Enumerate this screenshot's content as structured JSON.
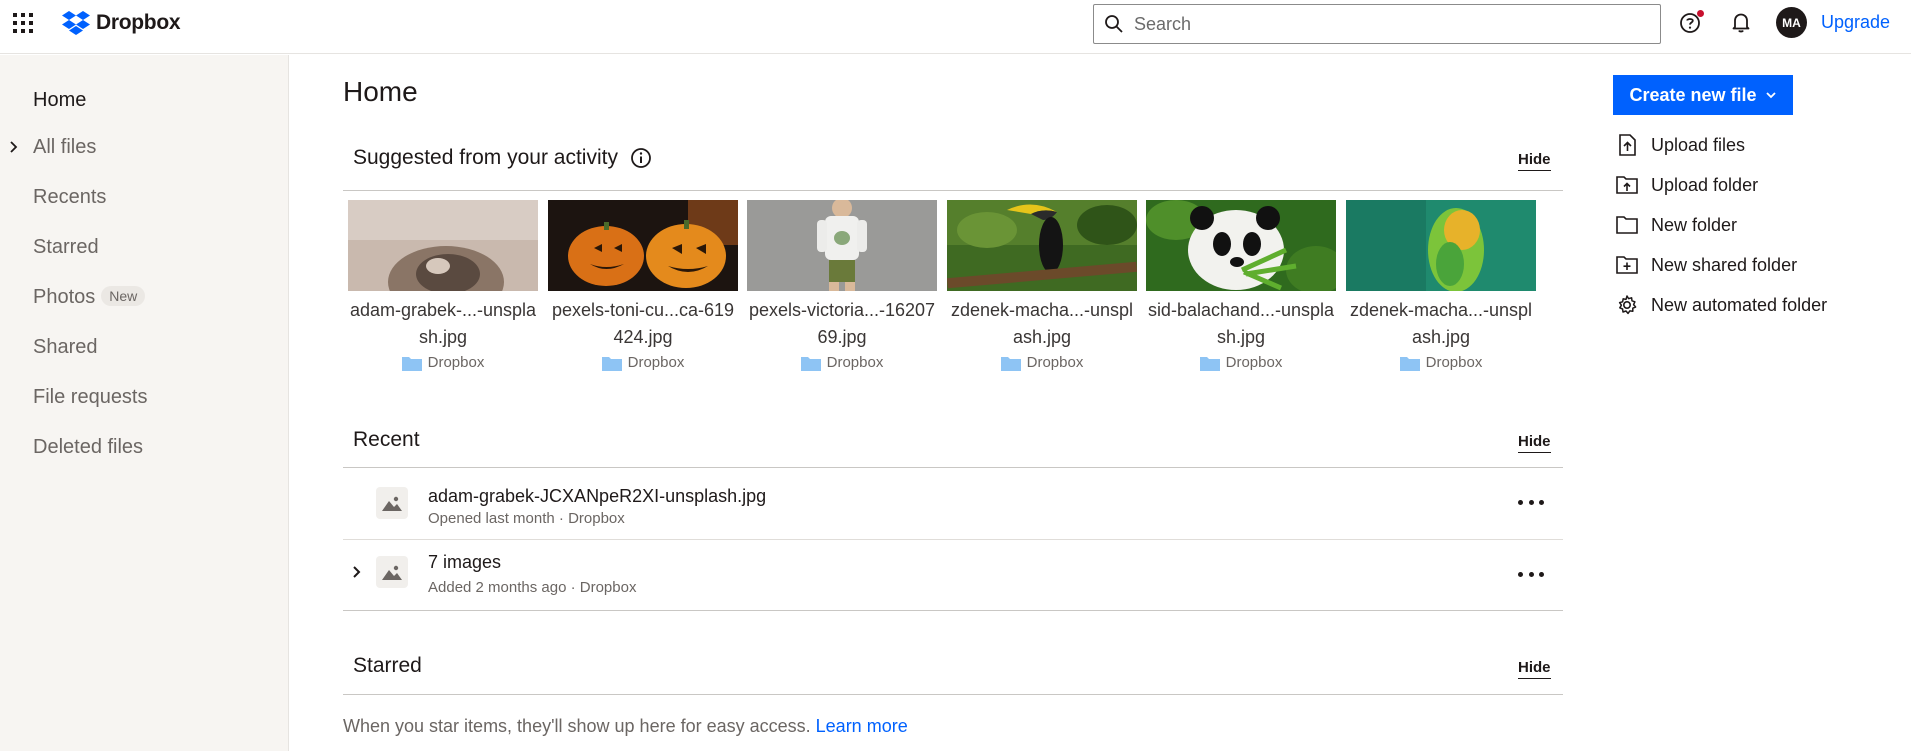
{
  "brand": {
    "name": "Dropbox",
    "accent": "#0061fe"
  },
  "header": {
    "search_placeholder": "Search",
    "avatar_initials": "MA",
    "upgrade_label": "Upgrade"
  },
  "sidebar": {
    "items": [
      {
        "label": "Home"
      },
      {
        "label": "All files"
      },
      {
        "label": "Recents"
      },
      {
        "label": "Starred"
      },
      {
        "label": "Photos",
        "badge": "New"
      },
      {
        "label": "Shared"
      },
      {
        "label": "File requests"
      },
      {
        "label": "Deleted files"
      }
    ]
  },
  "main": {
    "title": "Home",
    "suggested": {
      "title": "Suggested from your activity",
      "hide_label": "Hide",
      "cards": [
        {
          "name": "adam-grabek-...-unsplash.jpg",
          "location": "Dropbox"
        },
        {
          "name": "pexels-toni-cu...ca-619424.jpg",
          "location": "Dropbox"
        },
        {
          "name": "pexels-victoria...-1620769.jpg",
          "location": "Dropbox"
        },
        {
          "name": "zdenek-macha...-unsplash.jpg",
          "location": "Dropbox"
        },
        {
          "name": "sid-balachand...-unsplash.jpg",
          "location": "Dropbox"
        },
        {
          "name": "zdenek-macha...-unsplash.jpg",
          "location": "Dropbox"
        }
      ]
    },
    "recent": {
      "title": "Recent",
      "hide_label": "Hide",
      "rows": [
        {
          "title": "adam-grabek-JCXANpeR2XI-unsplash.jpg",
          "subtitle": "Opened last month · Dropbox"
        },
        {
          "title": "7 images",
          "subtitle": "Added 2 months ago · Dropbox"
        }
      ]
    },
    "starred": {
      "title": "Starred",
      "hide_label": "Hide",
      "empty_text": "When you star items, they'll show up here for easy access.",
      "learn_more": "Learn more"
    }
  },
  "actions": {
    "create_label": "Create new file",
    "items": [
      {
        "label": "Upload files",
        "icon": "upload-file-icon"
      },
      {
        "label": "Upload folder",
        "icon": "upload-folder-icon"
      },
      {
        "label": "New folder",
        "icon": "folder-icon"
      },
      {
        "label": "New shared folder",
        "icon": "shared-folder-icon"
      },
      {
        "label": "New automated folder",
        "icon": "gear-icon"
      }
    ]
  }
}
